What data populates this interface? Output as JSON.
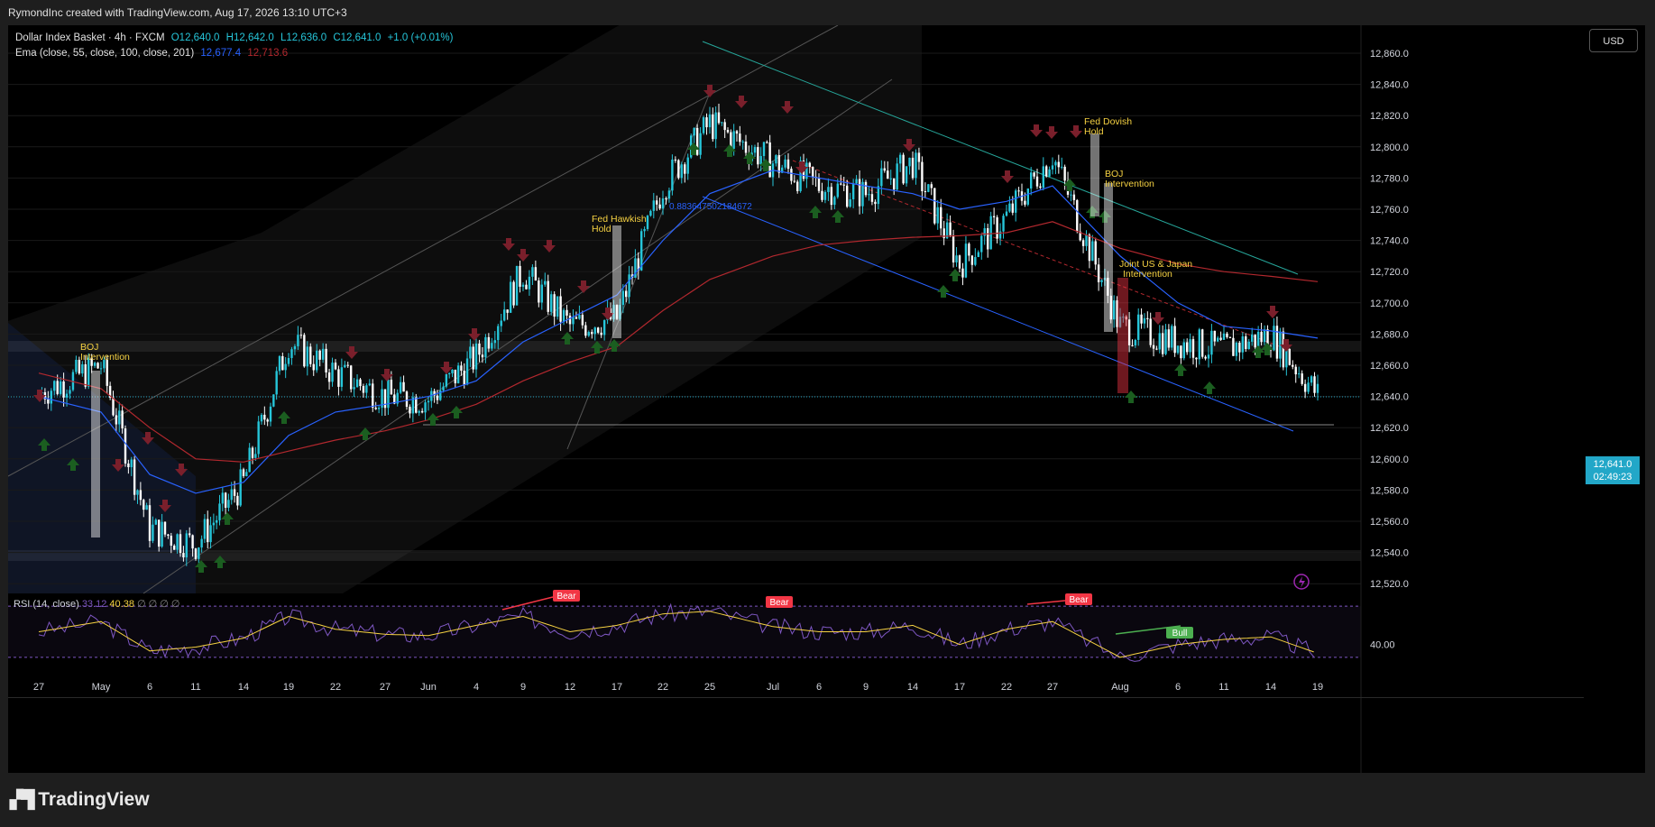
{
  "header": {
    "title": "RymondInc created with TradingView.com, Aug 17, 2026 13:10 UTC+3"
  },
  "legend": {
    "symbol": "Dollar Index Basket · 4h · FXCM",
    "open": "O12,640.0",
    "high": "H12,642.0",
    "low": "L12,636.0",
    "close": "C12,641.0",
    "change": "+1.0 (+0.01%)",
    "ema_label": "Ema (close, 55, close, 100, close, 201)",
    "ema_v1": "12,677.4",
    "ema_v2": "12,713.6"
  },
  "currency": "USD",
  "last_price": {
    "value": "12,641.0",
    "countdown": "02:49:23"
  },
  "price_axis": [
    "12,860.0",
    "12,840.0",
    "12,820.0",
    "12,800.0",
    "12,780.0",
    "12,760.0",
    "12,740.0",
    "12,720.0",
    "12,700.0",
    "12,680.0",
    "12,660.0",
    "12,640.0",
    "12,620.0",
    "12,600.0",
    "12,580.0",
    "12,560.0",
    "12,540.0",
    "12,520.0"
  ],
  "rsi": {
    "label": "RSI (14, close)",
    "v1": "33.12",
    "v2": "40.38",
    "extra": "∅ ∅ ∅ ∅",
    "axis_value": "40.00"
  },
  "time_axis": [
    "27",
    "May",
    "6",
    "11",
    "14",
    "19",
    "22",
    "27",
    "Jun",
    "4",
    "9",
    "12",
    "17",
    "22",
    "25",
    "Jul",
    "6",
    "9",
    "14",
    "17",
    "22",
    "27",
    "Aug",
    "6",
    "11",
    "14",
    "19"
  ],
  "annotations": [
    {
      "text": "BOJ\nIntervention"
    },
    {
      "text": "Fed Hawkish\nHold"
    },
    {
      "text": "Fed Dovish\nHold"
    },
    {
      "text": "BOJ\nIntervention"
    },
    {
      "text": "Joint US & Japan\nIntervention"
    }
  ],
  "channel_label": "0.883647502184672",
  "rsi_badges": [
    "Bear",
    "Bear",
    "Bear",
    "Bull"
  ],
  "colors": {
    "bull": "#26c6da",
    "bear": "#ffffff",
    "ema55": "#2962ff",
    "ema100": "#b2282e",
    "annotation": "#f5d142",
    "up_arrow": "#1b5e20",
    "down_arrow": "#7a1f2b",
    "bear_badge": "#f23645",
    "bull_badge": "#4caf50"
  },
  "chart_data": {
    "type": "line",
    "title": "Dollar Index Basket · 4h · FXCM",
    "ylim": [
      12510,
      12870
    ],
    "x": [
      "Apr 27",
      "May 1",
      "May 6",
      "May 11",
      "May 14",
      "May 19",
      "May 22",
      "May 27",
      "Jun 1",
      "Jun 4",
      "Jun 9",
      "Jun 12",
      "Jun 17",
      "Jun 22",
      "Jun 25",
      "Jul 1",
      "Jul 6",
      "Jul 9",
      "Jul 14",
      "Jul 17",
      "Jul 22",
      "Jul 27",
      "Aug 1",
      "Aug 6",
      "Aug 11",
      "Aug 14",
      "Aug 17"
    ],
    "series": [
      {
        "name": "Dollar Index Basket",
        "values": [
          12642,
          12660,
          12555,
          12545,
          12585,
          12675,
          12655,
          12640,
          12638,
          12665,
          12720,
          12685,
          12690,
          12775,
          12815,
          12790,
          12775,
          12770,
          12790,
          12725,
          12755,
          12795,
          12685,
          12675,
          12670,
          12680,
          12641
        ]
      },
      {
        "name": "Ema 55",
        "values": [
          12640,
          12630,
          12590,
          12578,
          12585,
          12615,
          12630,
          12635,
          12640,
          12650,
          12675,
          12690,
          12705,
          12740,
          12770,
          12785,
          12780,
          12775,
          12770,
          12760,
          12765,
          12775,
          12730,
          12700,
          12685,
          12682,
          12677.4
        ]
      },
      {
        "name": "Ema 100",
        "values": [
          12655,
          12645,
          12620,
          12600,
          12598,
          12605,
          12612,
          12618,
          12625,
          12635,
          12650,
          12662,
          12672,
          12695,
          12715,
          12730,
          12737,
          12740,
          12742,
          12743,
          12745,
          12752,
          12735,
          12725,
          12720,
          12717,
          12713.6
        ]
      }
    ],
    "rsi": {
      "ylim": [
        20,
        80
      ],
      "values": [
        50,
        58,
        35,
        38,
        45,
        62,
        52,
        48,
        47,
        55,
        62,
        50,
        55,
        64,
        66,
        54,
        50,
        50,
        55,
        40,
        52,
        58,
        30,
        40,
        44,
        46,
        33.12
      ]
    },
    "horizontal_level": 12622
  }
}
